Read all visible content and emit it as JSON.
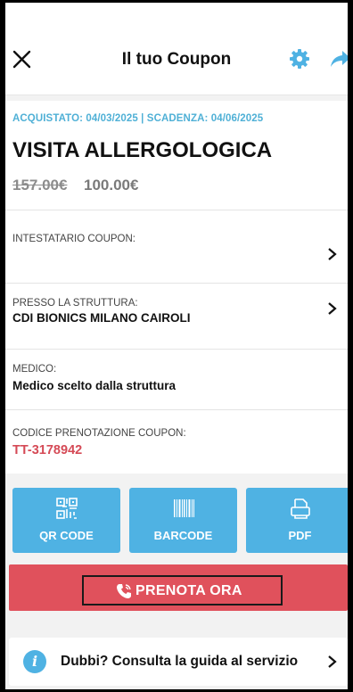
{
  "header": {
    "title": "Il tuo Coupon",
    "close_icon": "close-icon",
    "settings_icon": "gear-icon",
    "share_icon": "share-arrow-icon"
  },
  "coupon": {
    "dates": "ACQUISTATO: 04/03/2025 | SCADENZA: 04/06/2025",
    "service": "VISITA ALLERGOLOGICA",
    "price_old": "157.00€",
    "price_new": "100.00€"
  },
  "rows": {
    "holder": {
      "label": "INTESTATARIO COUPON:",
      "value": ""
    },
    "facility": {
      "label": "PRESSO LA STRUTTURA:",
      "value": "CDI BIONICS MILANO CAIROLI"
    },
    "doctor": {
      "label": "MEDICO:",
      "value": "Medico scelto dalla struttura"
    },
    "code": {
      "label": "CODICE PRENOTAZIONE COUPON:",
      "value": "TT-3178942"
    }
  },
  "actions": {
    "qr": {
      "label": "QR CODE",
      "icon": "qr-code-icon"
    },
    "barcode": {
      "label": "BARCODE",
      "icon": "barcode-icon"
    },
    "pdf": {
      "label": "PDF",
      "icon": "pdf-icon"
    }
  },
  "book": {
    "label": "PRENOTA ORA",
    "icon": "phone-icon"
  },
  "help": {
    "label": "Dubbi? Consulta la guida al servizio",
    "icon": "info-icon"
  },
  "colors": {
    "accent_blue": "#4fb2e3",
    "date_blue": "#4fb0d6",
    "book_red": "#e0515c",
    "code_red": "#d54a56"
  }
}
